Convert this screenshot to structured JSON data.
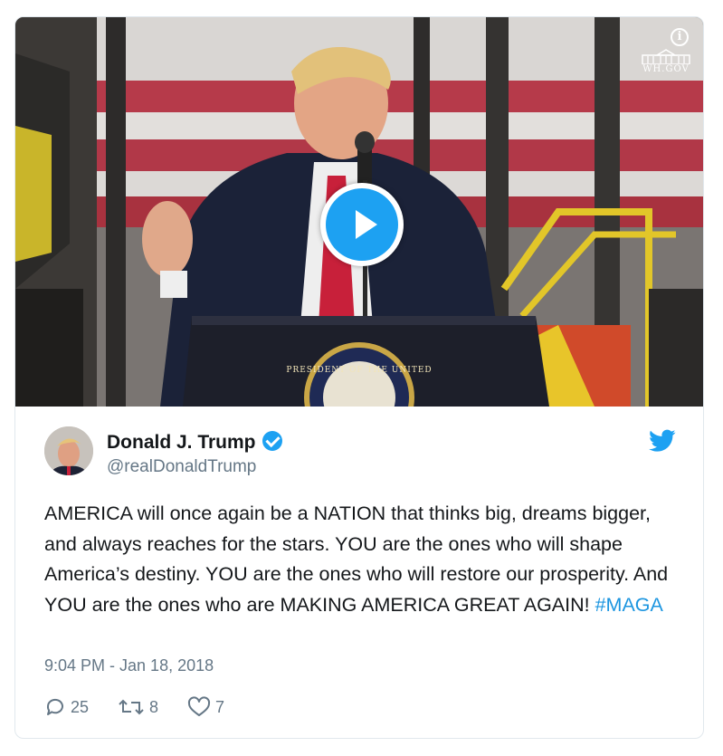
{
  "video": {
    "watermark": "WH.GOV",
    "info_icon": "info-icon",
    "seal_text": "PRESIDENT OF THE UNITED",
    "play_icon": "play-icon"
  },
  "author": {
    "name": "Donald J. Trump",
    "handle": "@realDonaldTrump",
    "verified": true,
    "avatar_icon": "avatar"
  },
  "tweet": {
    "text": "AMERICA will once again be a NATION that thinks big, dreams bigger, and always reaches for the stars. YOU are the ones who will shape America’s destiny. YOU are the ones who will restore our prosperity. And YOU are the ones who are MAKING AMERICA GREAT AGAIN! ",
    "hashtag": "#MAGA",
    "timestamp": "9:04 PM - Jan 18, 2018"
  },
  "actions": {
    "replies": "25",
    "retweets": "8",
    "likes": "7"
  },
  "colors": {
    "accent": "#1da1f2",
    "hashtag": "#1b95e0",
    "secondary_text": "#657786",
    "border": "#e1e8ed"
  }
}
